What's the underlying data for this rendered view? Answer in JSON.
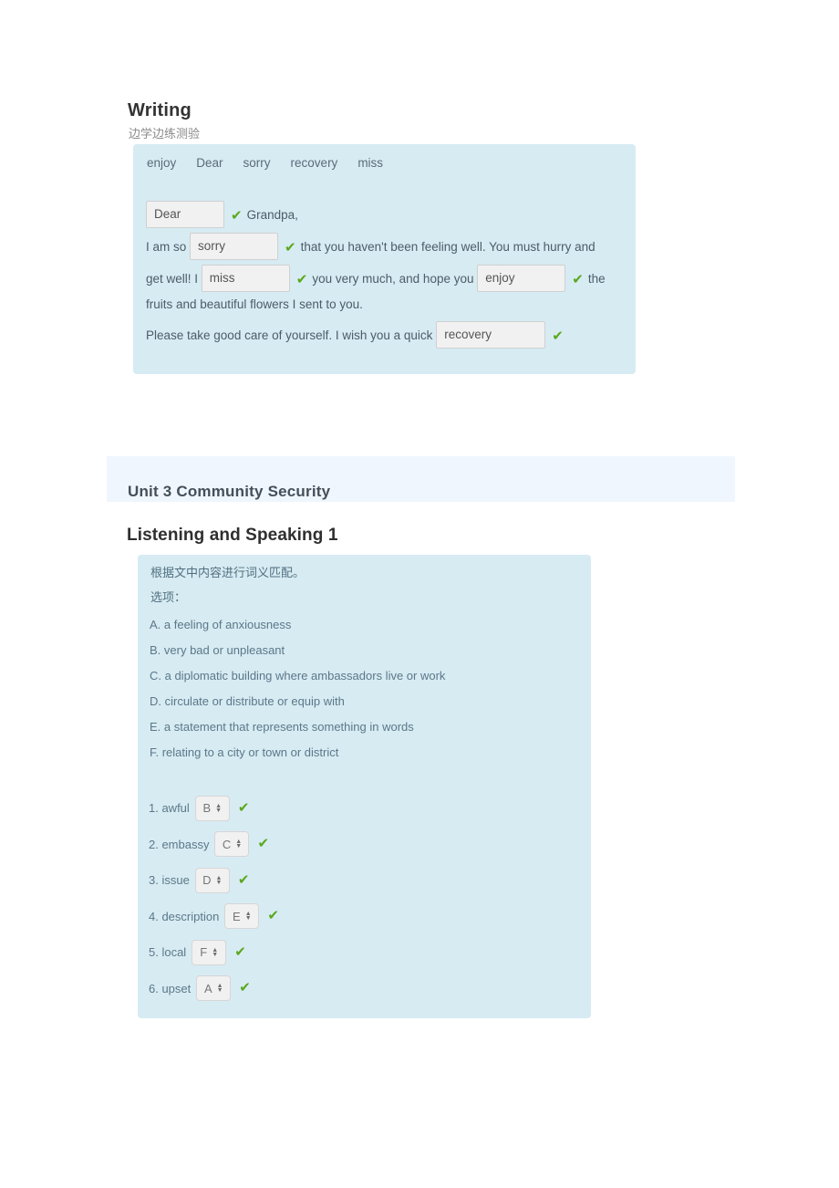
{
  "writing": {
    "title": "Writing",
    "subtitle": "边学边练测验",
    "word_bank": [
      "enjoy",
      "Dear",
      "sorry",
      "recovery",
      "miss"
    ],
    "check_icon": "✔",
    "lines": [
      {
        "id": "line-greeting",
        "pre": "",
        "blank": "Dear",
        "post": "Grandpa,"
      },
      {
        "id": "line-1",
        "pre": "I am so",
        "blank": "sorry",
        "post": "that you haven't been feeling well. You must hurry and"
      },
      {
        "id": "line-2a",
        "pre": "get well! I",
        "blank": "miss",
        "post": "you very much, and hope you",
        "blank2": "enjoy",
        "post2": "the"
      },
      {
        "id": "line-2b",
        "text": "fruits and beautiful flowers I sent to you."
      },
      {
        "id": "line-3",
        "pre": "Please take good care of yourself. I wish you a quick",
        "blank": "recovery",
        "post": ""
      }
    ]
  },
  "unit": {
    "banner_label": "Unit 3 Community Security",
    "banner_color": "#eff6fd"
  },
  "listening": {
    "section_title": "Listening and Speaking 1",
    "instruction": "根据文中内容进行词义匹配。",
    "options_label": "选项：",
    "check_icon": "✔",
    "options": [
      "A. a feeling of anxiousness",
      "B. very bad or unpleasant",
      "C. a diplomatic building where ambassadors live or work",
      "D. circulate or distribute or equip with",
      "E. a statement that represents something in words",
      "F. relating to a city or town or district"
    ],
    "matches": [
      {
        "label": "1. awful",
        "value": "B"
      },
      {
        "label": "2. embassy",
        "value": "C"
      },
      {
        "label": "3. issue",
        "value": "D"
      },
      {
        "label": "4. description",
        "value": "E"
      },
      {
        "label": "5. local",
        "value": "F"
      },
      {
        "label": "6. upset",
        "value": "A"
      }
    ]
  },
  "theme": {
    "panel_bg": "#d7ebf3",
    "check_color": "#5aa81b",
    "text_color": "#4d5c68"
  }
}
